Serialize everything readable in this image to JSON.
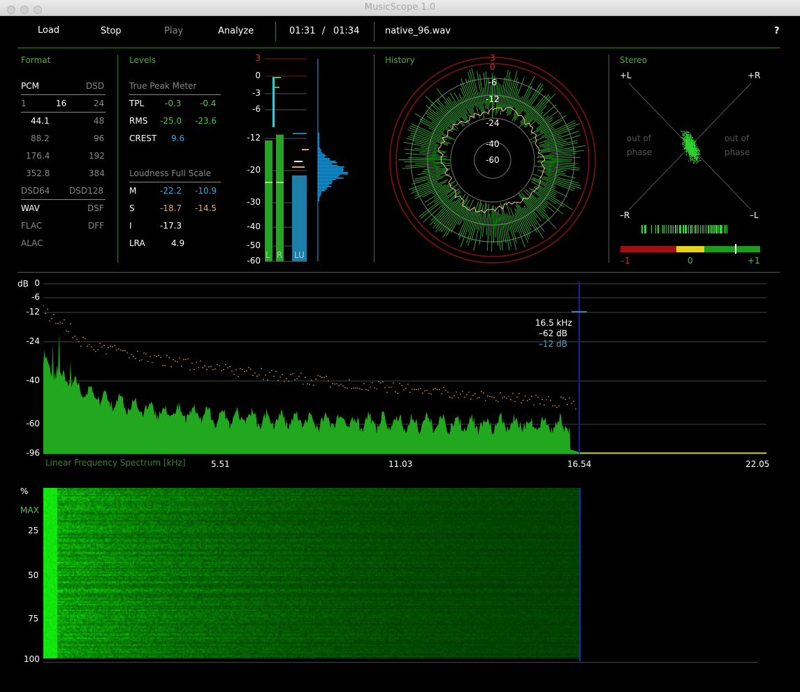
{
  "window": {
    "title": "MusicScope 1.0"
  },
  "toolbar": {
    "load": "Load",
    "stop": "Stop",
    "play": "Play",
    "analyze": "Analyze",
    "time_current": "01:31",
    "time_sep": "/",
    "time_total": "01:34",
    "filename": "native_96.wav",
    "help": "?"
  },
  "format": {
    "title": "Format",
    "pcm": "PCM",
    "dsd": "DSD",
    "bits": [
      "1",
      "16",
      "24"
    ],
    "rates": [
      [
        "44.1",
        "48"
      ],
      [
        "88.2",
        "96"
      ],
      [
        "176.4",
        "192"
      ],
      [
        "352.8",
        "384"
      ],
      [
        "DSD64",
        "DSD128"
      ]
    ],
    "containers": [
      [
        "WAV",
        "DSF"
      ],
      [
        "FLAC",
        "DFF"
      ],
      [
        "ALAC",
        ""
      ]
    ]
  },
  "levels": {
    "title": "Levels",
    "tpm_title": "True Peak Meter",
    "tpl": {
      "label": "TPL",
      "l": "-0.3",
      "r": "-0.4"
    },
    "rms": {
      "label": "RMS",
      "l": "-25.0",
      "r": "-23.6"
    },
    "crest": {
      "label": "CREST",
      "v": "9.6"
    },
    "lfs_title": "Loudness Full Scale",
    "m": {
      "label": "M",
      "a": "-22.2",
      "b": "-10.9"
    },
    "s": {
      "label": "S",
      "a": "-18.7",
      "b": "-14.5"
    },
    "i": {
      "label": "I",
      "a": "-17.3"
    },
    "lra": {
      "label": "LRA",
      "a": "4.9"
    },
    "meter_ticks": [
      "3",
      "0",
      "-3",
      "-6",
      "-12",
      "-20",
      "-30",
      "-40",
      "-50",
      "-60"
    ],
    "meter_labels": {
      "l": "L",
      "r": "R",
      "lu": "LU"
    },
    "meter_values": {
      "l_rms": -12.5,
      "r_rms": -11.2,
      "l_peak": -0.3,
      "r_peak": -0.4,
      "lu": -21.5
    }
  },
  "history": {
    "title": "History",
    "ticks": [
      "3",
      "0",
      "-6",
      "-12",
      "-24",
      "-40",
      "-60"
    ]
  },
  "stereo": {
    "title": "Stereo",
    "plus_l": "+L",
    "plus_r": "+R",
    "minus_r": "–R",
    "minus_l": "–L",
    "out_of_phase": "out of",
    "phase": "phase",
    "corr_min": "–1",
    "corr_mid": "0",
    "corr_max": "+1",
    "correlation": 0.65,
    "colors": {
      "red": "#a01010",
      "yellow": "#e6d21e",
      "green": "#1e9a1e"
    }
  },
  "spectrum": {
    "db_label": "dB",
    "y_ticks": [
      "0",
      "-6",
      "-12",
      "-24",
      "-40",
      "-60",
      "-96"
    ],
    "x_ticks": [
      "5.51",
      "11.03",
      "16.54",
      "22.05"
    ],
    "caption": "Linear Frequency Spectrum [kHz]",
    "cursor": {
      "freq": "16.5 kHz",
      "db": "–62 dB",
      "db2": "–12 dB"
    }
  },
  "spectrogram": {
    "y_ticks": [
      "%",
      "MAX",
      "25",
      "50",
      "75",
      "100"
    ]
  }
}
